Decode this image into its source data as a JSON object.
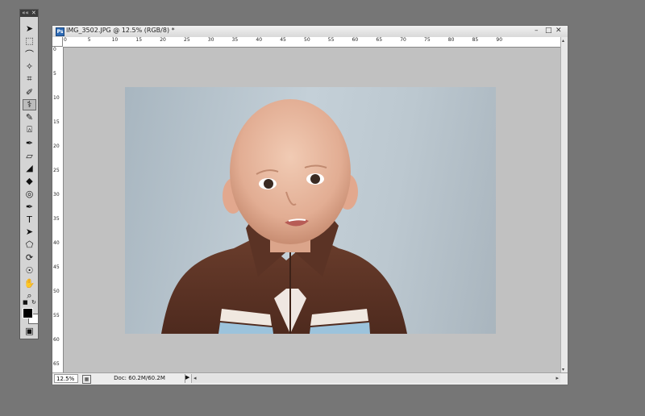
{
  "tools_panel": {
    "collapse_label": "««",
    "close_label": "✕",
    "tools": [
      {
        "name": "move-tool-icon",
        "glyph": "➤"
      },
      {
        "name": "marquee-tool-icon",
        "glyph": "⬚"
      },
      {
        "name": "lasso-tool-icon",
        "glyph": "⌒"
      },
      {
        "name": "magic-wand-tool-icon",
        "glyph": "✧"
      },
      {
        "name": "crop-tool-icon",
        "glyph": "⌗"
      },
      {
        "name": "eyedropper-tool-icon",
        "glyph": "✐"
      },
      {
        "name": "healing-brush-tool-icon",
        "glyph": "⚕"
      },
      {
        "name": "brush-tool-icon",
        "glyph": "✎"
      },
      {
        "name": "clone-stamp-tool-icon",
        "glyph": "⍓"
      },
      {
        "name": "history-brush-tool-icon",
        "glyph": "✒"
      },
      {
        "name": "eraser-tool-icon",
        "glyph": "▱"
      },
      {
        "name": "paint-bucket-tool-icon",
        "glyph": "◢"
      },
      {
        "name": "blur-tool-icon",
        "glyph": "◆"
      },
      {
        "name": "dodge-tool-icon",
        "glyph": "◎"
      },
      {
        "name": "pen-tool-icon",
        "glyph": "✒"
      },
      {
        "name": "type-tool-icon",
        "glyph": "T"
      },
      {
        "name": "path-selection-tool-icon",
        "glyph": "➤"
      },
      {
        "name": "shape-tool-icon",
        "glyph": "⬠"
      },
      {
        "name": "3d-rotate-tool-icon",
        "glyph": "⟳"
      },
      {
        "name": "3d-orbit-tool-icon",
        "glyph": "☉"
      },
      {
        "name": "hand-tool-icon",
        "glyph": "✋"
      },
      {
        "name": "zoom-tool-icon",
        "glyph": "⌕"
      }
    ],
    "selected_tool": "healing-brush-tool-icon",
    "foreground_color": "#000000",
    "background_color": "#ffffff",
    "quick_mask_glyph": "▣"
  },
  "document": {
    "title": "IMG_3502.JPG @ 12.5% (RGB/8) *",
    "app_icon_label": "Ps",
    "minimize_glyph": "–",
    "maximize_glyph": "□",
    "close_glyph": "✕",
    "ruler_top_labels": [
      "0",
      "5",
      "10",
      "15",
      "20",
      "25",
      "30",
      "35",
      "40",
      "45",
      "50",
      "55",
      "60",
      "65",
      "70",
      "75",
      "80",
      "85",
      "90"
    ],
    "ruler_left_labels": [
      "0",
      "5",
      "10",
      "15",
      "20",
      "25",
      "30",
      "35",
      "40",
      "45",
      "50",
      "55",
      "60",
      "65"
    ],
    "status": {
      "zoom": "12.5%",
      "doc_info": "Doc: 60.2M/60.2M",
      "arrow": "▶",
      "scroll_left": "◂",
      "scroll_right": "▸"
    },
    "vscroll_up": "▴",
    "vscroll_down": "▾",
    "canvas_background": "#c1c1c1"
  }
}
